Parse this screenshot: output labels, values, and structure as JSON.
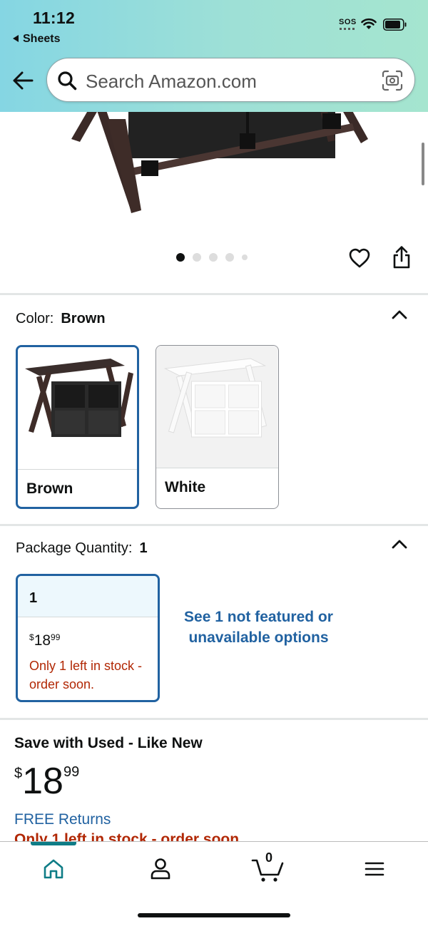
{
  "status_bar": {
    "time": "11:12",
    "back_app": "Sheets",
    "sos": "SOS"
  },
  "search": {
    "placeholder": "Search Amazon.com"
  },
  "image_carousel": {
    "total_dots": 5,
    "active_index": 0
  },
  "color": {
    "label": "Color:",
    "selected_value": "Brown",
    "options": [
      {
        "name": "Brown",
        "selected": true
      },
      {
        "name": "White",
        "selected": false
      }
    ]
  },
  "package_quantity": {
    "label": "Package Quantity:",
    "selected_value": "1",
    "option": {
      "value": "1",
      "price_symbol": "$",
      "price_whole": "18",
      "price_fraction": "99",
      "stock_message": "Only 1 left in stock - order soon."
    },
    "see_more_link": "See 1 not featured or unavailable options"
  },
  "used_offer": {
    "title": "Save with Used - Like New",
    "price_symbol": "$",
    "price_whole": "18",
    "price_fraction": "99",
    "free_returns": "FREE Returns",
    "stock_message": "Only 1 left in stock - order soon."
  },
  "bottom_nav": {
    "cart_count": "0",
    "items": [
      "home-icon",
      "account-icon",
      "cart-icon",
      "menu-icon"
    ],
    "active": "home"
  },
  "colors": {
    "header_gradient_start": "#85d6e3",
    "header_gradient_end": "#a5e5cf",
    "link_blue": "#2162a1",
    "stock_red": "#b12704",
    "teal_active": "#0e7c86"
  }
}
